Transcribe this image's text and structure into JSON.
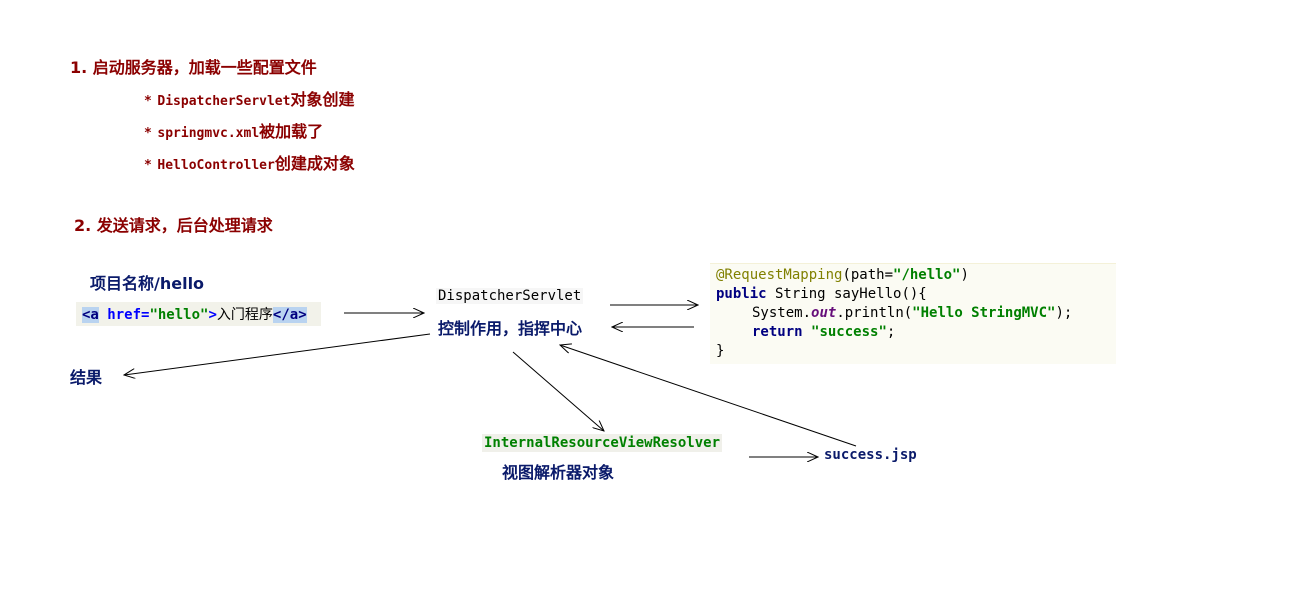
{
  "step1": {
    "title": "1. 启动服务器，加载一些配置文件",
    "bullets": [
      {
        "code": "DispatcherServlet",
        "text": "对象创建"
      },
      {
        "code": "springmvc.xml",
        "text": "被加载了"
      },
      {
        "code": "HelloController",
        "text": "创建成对象"
      }
    ],
    "bullet_mark": "*"
  },
  "step2": {
    "title": "2. 发送请求，后台处理请求"
  },
  "project_label": "项目名称/hello",
  "html_snippet": {
    "open_tag": "<a",
    "attr": "href=",
    "attr_value": "\"hello\"",
    "after_attr": ">",
    "text": "入门程序",
    "close_tag": "</a>"
  },
  "dispatcher": {
    "name": "DispatcherServlet",
    "caption": "控制作用，指挥中心"
  },
  "code": {
    "line1_annotation": "@RequestMapping",
    "line1_open": "(path=",
    "line1_value": "\"/hello\"",
    "line1_close": ")",
    "line2_kw": "public",
    "line2_rest": " String sayHello(){",
    "line3_a": "System.",
    "line3_out": "out",
    "line3_b": ".println(",
    "line3_str": "\"Hello StringMVC\"",
    "line3_c": ");",
    "line4_kw": "return",
    "line4_str": "\"success\"",
    "line4_end": ";",
    "line5": "}"
  },
  "result_label": "结果",
  "resolver": {
    "name": "InternalResourceViewResolver",
    "caption": "视图解析器对象"
  },
  "success_jsp": "success.jsp",
  "colors": {
    "step_text": "#8b0000",
    "label_text": "#0a1a6a",
    "keyword": "#000080",
    "string": "#008000",
    "annotation": "#808000"
  }
}
